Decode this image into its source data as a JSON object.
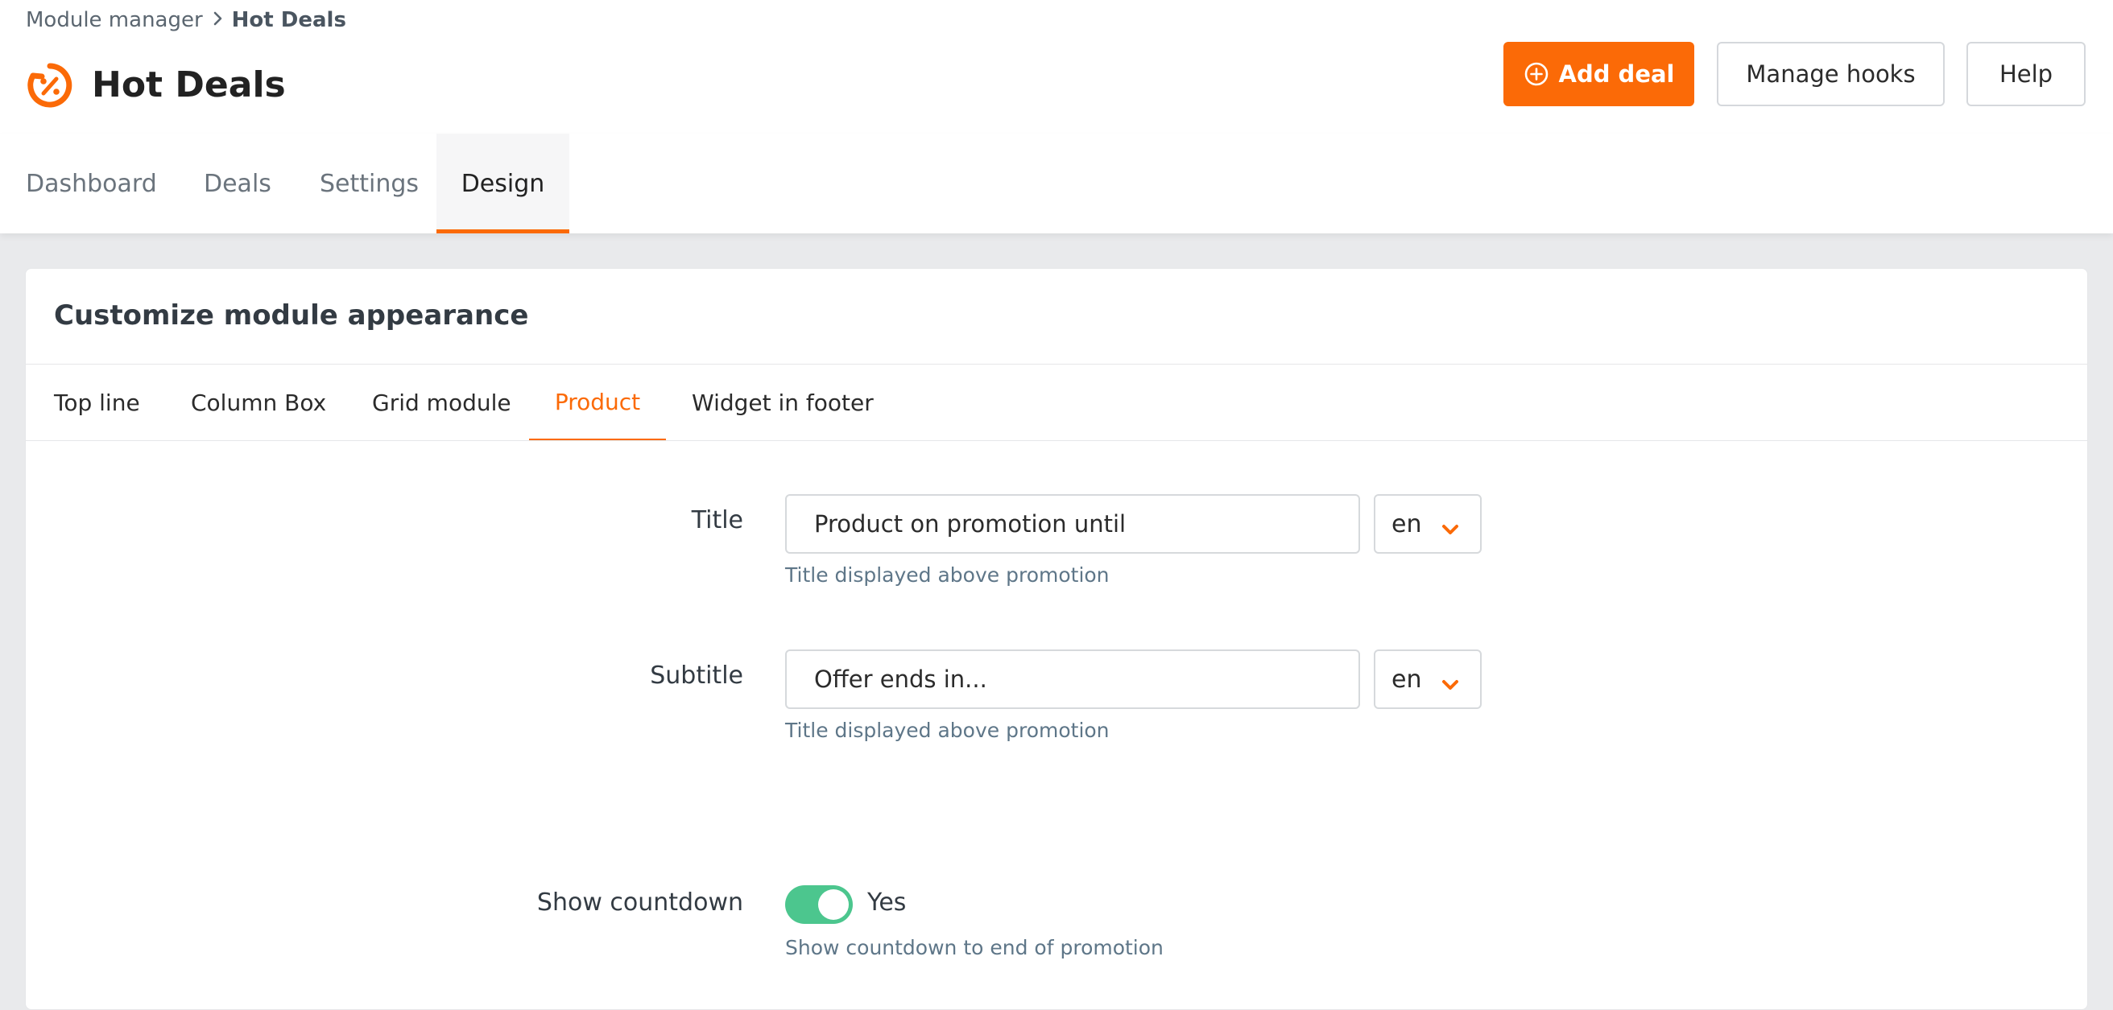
{
  "breadcrumb": {
    "parent": "Module manager",
    "separator_icon": "chevron-right-icon",
    "current": "Hot Deals"
  },
  "header": {
    "title": "Hot Deals",
    "logo_icon": "hot-deals-timer-icon",
    "add_deal_label": "Add deal",
    "add_deal_icon": "plus-circle-icon",
    "manage_hooks_label": "Manage hooks",
    "help_label": "Help"
  },
  "main_tabs": [
    {
      "label": "Dashboard",
      "active": false
    },
    {
      "label": "Deals",
      "active": false
    },
    {
      "label": "Settings",
      "active": false
    },
    {
      "label": "Design",
      "active": true
    }
  ],
  "card": {
    "title": "Customize module appearance",
    "sub_tabs": [
      {
        "label": "Top line",
        "active": false
      },
      {
        "label": "Column Box",
        "active": false
      },
      {
        "label": "Grid module",
        "active": false
      },
      {
        "label": "Product",
        "active": true
      },
      {
        "label": "Widget in footer",
        "active": false
      }
    ],
    "fields": {
      "title": {
        "label": "Title",
        "value": "Product on promotion until",
        "language": "en",
        "help": "Title displayed above promotion"
      },
      "subtitle": {
        "label": "Subtitle",
        "value": "Offer ends in...",
        "language": "en",
        "help": "Title displayed above promotion"
      },
      "show_countdown": {
        "label": "Show countdown",
        "enabled": true,
        "state_label": "Yes",
        "help": "Show countdown to end of promotion"
      }
    }
  },
  "colors": {
    "accent": "#fb6a07",
    "toggle_on": "#4cc68e",
    "help_text": "#5e7688",
    "background": "#e9eaec"
  }
}
